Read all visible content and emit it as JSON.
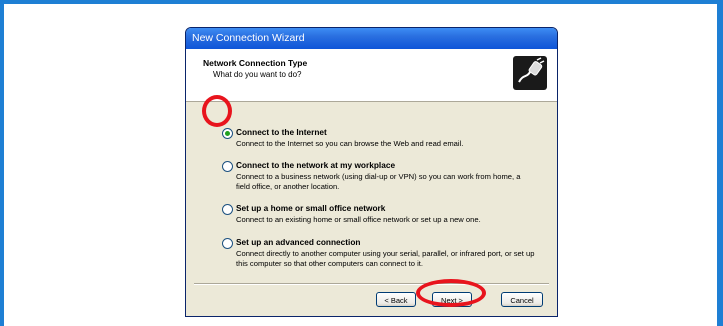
{
  "window": {
    "title": "New Connection Wizard",
    "header_title": "Network Connection Type",
    "header_subtitle": "What do you want to do?",
    "header_icon": "network-plug-icon"
  },
  "options": [
    {
      "label": "Connect to the Internet",
      "desc": "Connect to the Internet so you can browse the Web and read email.",
      "selected": true
    },
    {
      "label": "Connect to the network at my workplace",
      "desc": "Connect to a business network (using dial-up or VPN) so you can work from home, a field office, or another location.",
      "selected": false
    },
    {
      "label": "Set up a home or small office network",
      "desc": "Connect to an existing home or small office network or set up a new one.",
      "selected": false
    },
    {
      "label": "Set up an advanced connection",
      "desc": "Connect directly to another computer using your serial, parallel, or infrared port, or set up this computer so that other computers can connect to it.",
      "selected": false
    }
  ],
  "buttons": {
    "back": "< Back",
    "next": "Next >",
    "cancel": "Cancel"
  },
  "highlight_color": "#e8141d",
  "border_color": "#1e7fd4"
}
